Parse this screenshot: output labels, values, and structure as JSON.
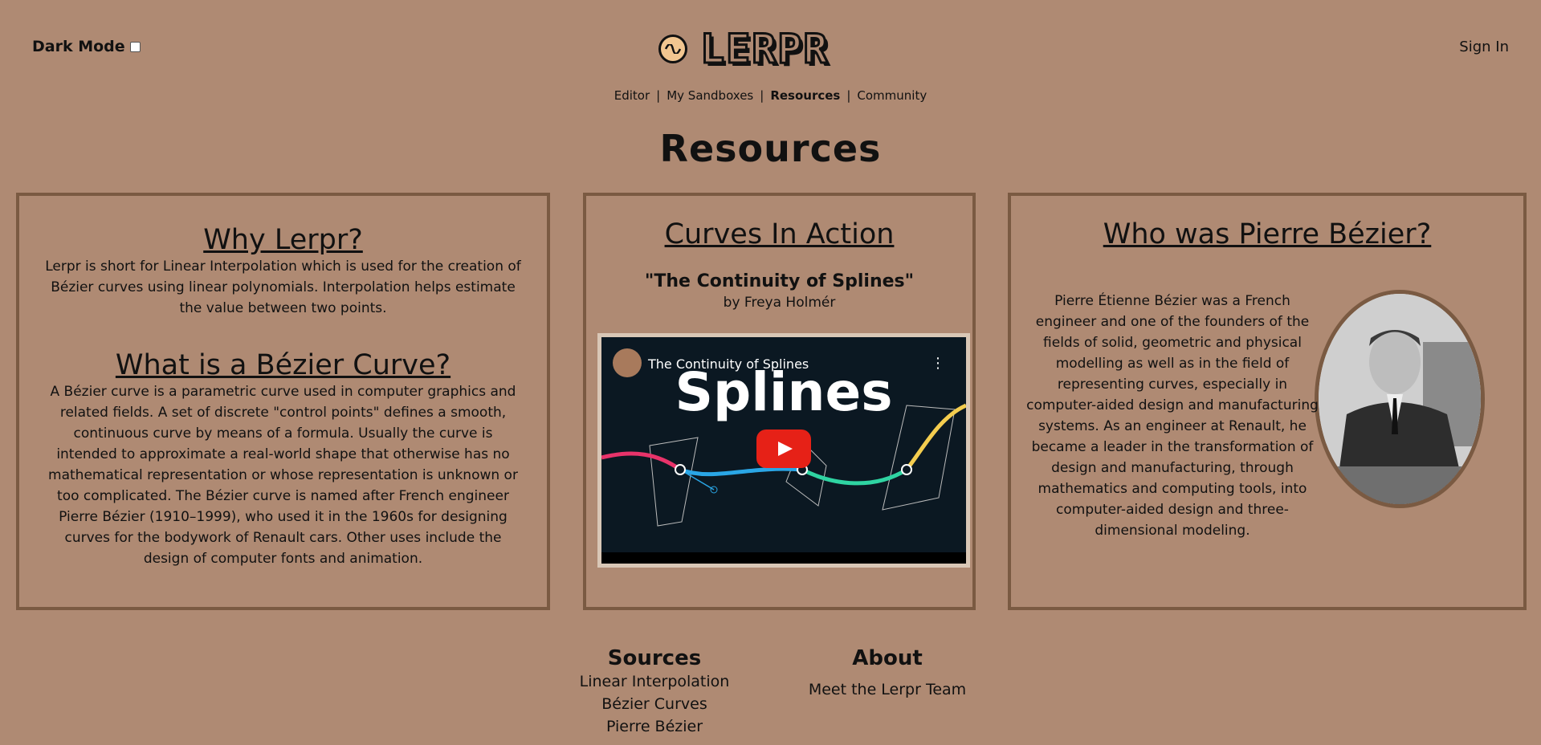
{
  "header": {
    "dark_mode_label": "Dark Mode",
    "logo_text": "LERPR",
    "sign_in": "Sign In"
  },
  "nav": [
    {
      "label": "Editor"
    },
    {
      "label": "My Sandboxes"
    },
    {
      "label": "Resources"
    },
    {
      "label": "Community"
    }
  ],
  "page_title": "Resources",
  "cards": {
    "why": {
      "title": "Why Lerpr?",
      "body": "Lerpr is short for Linear Interpolation which is used for the creation of Bézier curves using linear polynomials. Interpolation helps estimate the value between two points."
    },
    "what": {
      "title": "What is a Bézier Curve?",
      "body": "A Bézier curve is a parametric curve used in computer graphics and related fields. A set of discrete \"control points\" defines a smooth, continuous curve by means of a formula. Usually the curve is intended to approximate a real-world shape that otherwise has no mathematical representation or whose representation is unknown or too complicated. The Bézier curve is named after French engineer Pierre Bézier (1910–1999), who used it in the 1960s for designing curves for the bodywork of Renault cars. Other uses include the design of computer fonts and animation."
    },
    "curves": {
      "title": "Curves In Action",
      "video_quote": "\"The Continuity of Splines\"",
      "video_author": "by Freya Holmér",
      "video_embed_title": "The Continuity of Splines",
      "video_thumb_text": "Splines"
    },
    "bezier": {
      "title": "Who was Pierre Bézier?",
      "body": "Pierre Étienne Bézier was a French engineer and one of the founders of the fields of solid, geometric and physical modelling as well as in the field of representing curves, especially in computer-aided design and manufacturing systems. As an engineer at Renault, he became a leader in the transformation of design and manufacturing, through mathematics and computing tools, into computer-aided design and three-dimensional modeling."
    }
  },
  "footer": {
    "sources_title": "Sources",
    "sources": [
      "Linear Interpolation",
      "Bézier Curves",
      "Pierre Bézier"
    ],
    "about_title": "About",
    "about_link": "Meet the Lerpr Team"
  }
}
